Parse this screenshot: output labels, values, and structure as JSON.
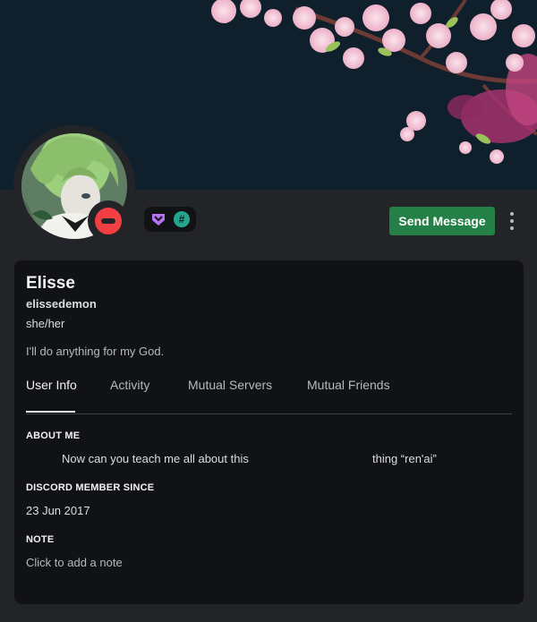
{
  "profile": {
    "display_name": "Elisse",
    "username": "elissedemon",
    "pronouns": "she/her",
    "custom_status": "I'll do anything for my God.",
    "status": "do-not-disturb",
    "badges": [
      "nitro-badge-icon",
      "hashtag-badge-icon"
    ]
  },
  "actions": {
    "send_message": "Send Message",
    "more_icon": "more-vertical-icon"
  },
  "tabs": [
    {
      "label": "User Info",
      "active": true
    },
    {
      "label": "Activity",
      "active": false
    },
    {
      "label": "Mutual Servers",
      "active": false
    },
    {
      "label": "Mutual Friends",
      "active": false
    }
  ],
  "about_me": {
    "title": "ABOUT ME",
    "text_part1": "Now can you teach me all about this",
    "text_part2": "thing “ren'ai”"
  },
  "member_since": {
    "title": "DISCORD MEMBER SINCE",
    "date": "23 Jun 2017"
  },
  "note": {
    "title": "NOTE",
    "placeholder": "Click to add a note"
  },
  "colors": {
    "banner": "#0f1f2b",
    "send_button": "#248046",
    "dnd_status": "#f23f43",
    "panel": "#111214",
    "card": "#232428"
  }
}
